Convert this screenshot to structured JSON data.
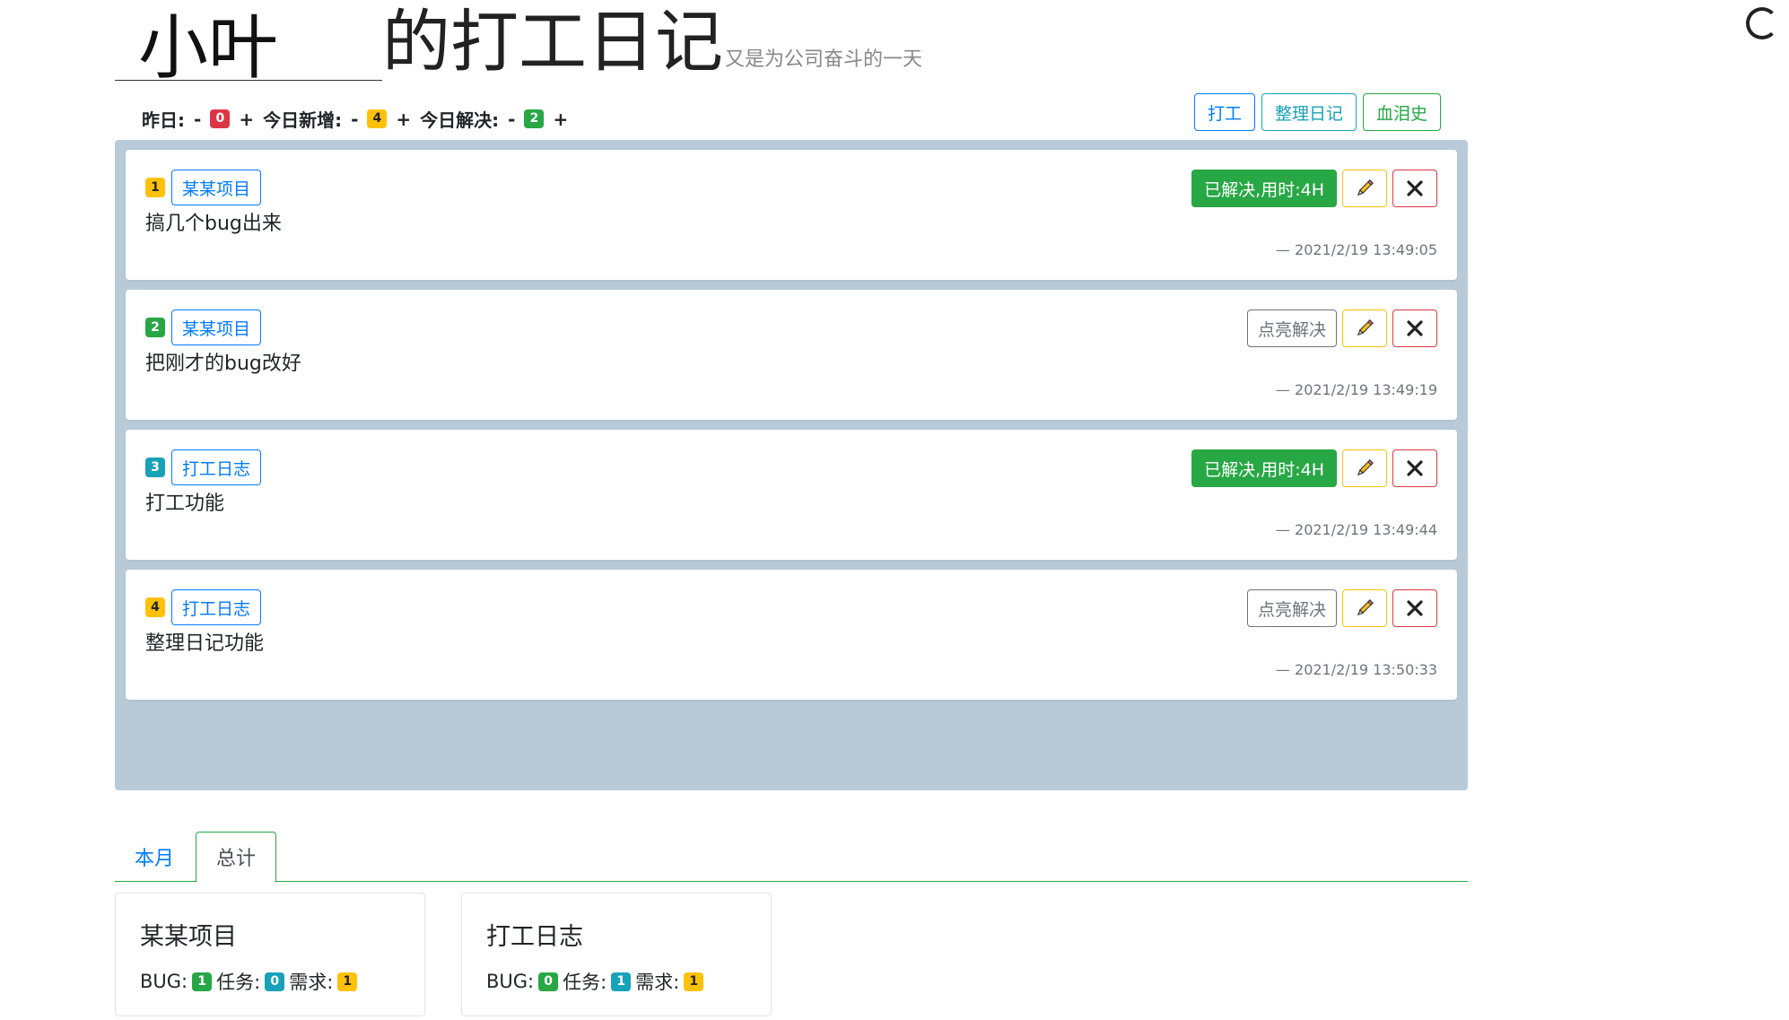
{
  "header": {
    "name_value": "小叶",
    "title": "的打工日记",
    "subtitle": "又是为公司奋斗的一天"
  },
  "stats": {
    "yesterday_label": "昨日:",
    "yesterday_count": "0",
    "new_label": "今日新增:",
    "new_count": "4",
    "solved_label": "今日解决:",
    "solved_count": "2",
    "minus": "-",
    "plus": "+"
  },
  "nav": {
    "work": "打工",
    "organize": "整理日记",
    "history": "血泪史"
  },
  "entries": [
    {
      "index": "1",
      "project": "某某项目",
      "text": "搞几个bug出来",
      "status": "已解决,用时:4H",
      "solved": true,
      "time": "— 2021/2/19 13:49:05",
      "badge_color": "#ffc107"
    },
    {
      "index": "2",
      "project": "某某项目",
      "text": "把刚才的bug改好",
      "status": "点亮解决",
      "solved": false,
      "time": "— 2021/2/19 13:49:19",
      "badge_color": "#28a745"
    },
    {
      "index": "3",
      "project": "打工日志",
      "text": "打工功能",
      "status": "已解决,用时:4H",
      "solved": true,
      "time": "— 2021/2/19 13:49:44",
      "badge_color": "#17a2b8"
    },
    {
      "index": "4",
      "project": "打工日志",
      "text": "整理日记功能",
      "status": "点亮解决",
      "solved": false,
      "time": "— 2021/2/19 13:50:33",
      "badge_color": "#ffc107"
    }
  ],
  "tabs": {
    "month": "本月",
    "total": "总计",
    "active": "总计"
  },
  "summary": [
    {
      "title": "某某项目",
      "bug_label": "BUG:",
      "bug": "1",
      "task_label": "任务:",
      "task": "0",
      "req_label": "需求:",
      "req": "1"
    },
    {
      "title": "打工日志",
      "bug_label": "BUG:",
      "bug": "0",
      "task_label": "任务:",
      "task": "1",
      "req_label": "需求:",
      "req": "1"
    }
  ],
  "icons": {
    "edit": "pencil-icon",
    "delete": "close-icon",
    "loading": "spinner-icon"
  }
}
